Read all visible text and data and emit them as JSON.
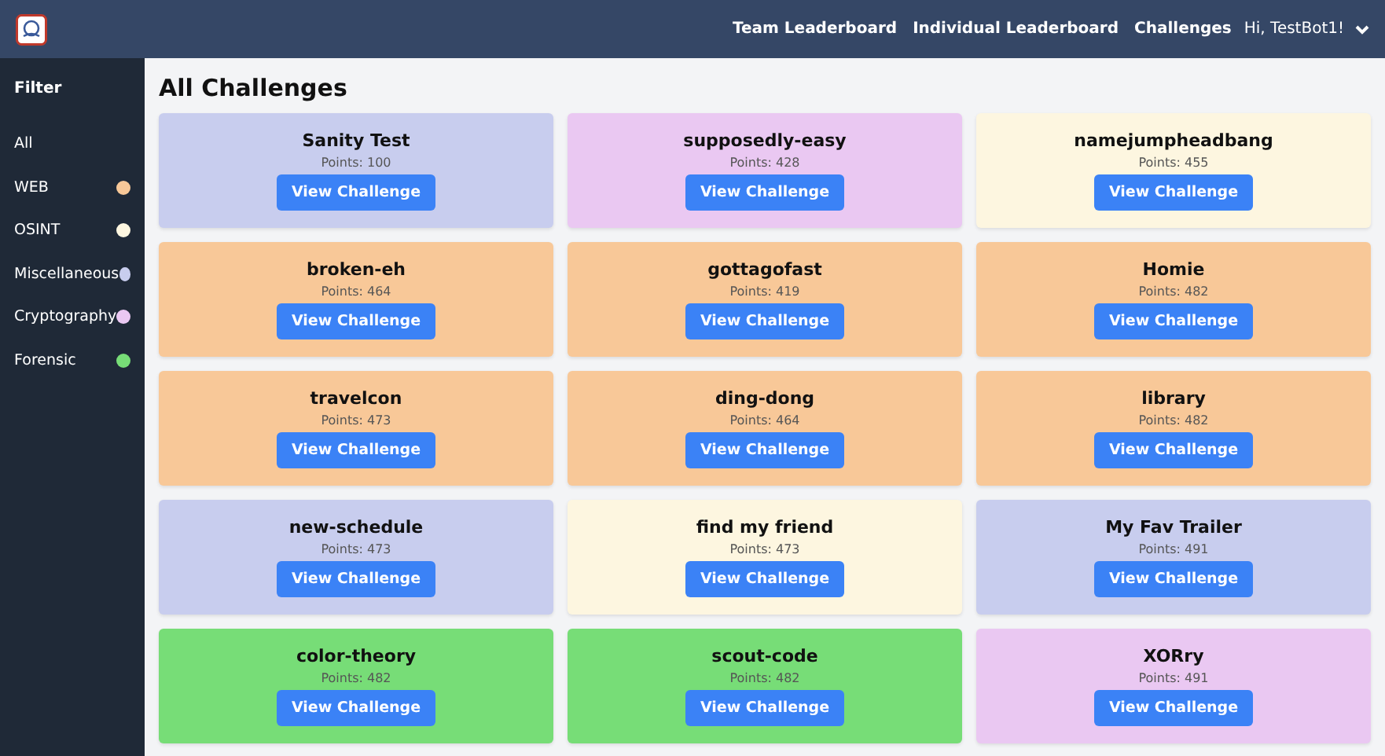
{
  "nav": {
    "links": [
      "Team Leaderboard",
      "Individual Leaderboard",
      "Challenges"
    ],
    "user": "Hi, TestBot1!"
  },
  "sidebar": {
    "title": "Filter",
    "items": [
      {
        "label": "All"
      },
      {
        "label": "WEB",
        "color": "#f8c898"
      },
      {
        "label": "OSINT",
        "color": "#fdf6e0"
      },
      {
        "label": "Miscellaneous",
        "color": "#c8cdee"
      },
      {
        "label": "Cryptography",
        "color": "#eac8f2"
      },
      {
        "label": "Forensic",
        "color": "#77dd77"
      }
    ]
  },
  "heading": "All Challenges",
  "challenges": [
    {
      "name": "Sanity Test",
      "points": "Points: 100",
      "color": "#c8cdee",
      "button": "View Challenge"
    },
    {
      "name": "supposedly-easy",
      "points": "Points: 428",
      "color": "#eac8f2",
      "button": "View Challenge"
    },
    {
      "name": "namejumpheadbang",
      "points": "Points: 455",
      "color": "#fdf6e0",
      "button": "View Challenge"
    },
    {
      "name": "broken-eh",
      "points": "Points: 464",
      "color": "#f8c898",
      "button": "View Challenge"
    },
    {
      "name": "gottagofast",
      "points": "Points: 419",
      "color": "#f8c898",
      "button": "View Challenge"
    },
    {
      "name": "Homie",
      "points": "Points: 482",
      "color": "#f8c898",
      "button": "View Challenge"
    },
    {
      "name": "travelcon",
      "points": "Points: 473",
      "color": "#f8c898",
      "button": "View Challenge"
    },
    {
      "name": "ding-dong",
      "points": "Points: 464",
      "color": "#f8c898",
      "button": "View Challenge"
    },
    {
      "name": "library",
      "points": "Points: 482",
      "color": "#f8c898",
      "button": "View Challenge"
    },
    {
      "name": "new-schedule",
      "points": "Points: 473",
      "color": "#c8cdee",
      "button": "View Challenge"
    },
    {
      "name": "find my friend",
      "points": "Points: 473",
      "color": "#fdf6e0",
      "button": "View Challenge"
    },
    {
      "name": "My Fav Trailer",
      "points": "Points: 491",
      "color": "#c8cdee",
      "button": "View Challenge"
    },
    {
      "name": "color-theory",
      "points": "Points: 482",
      "color": "#77dd77",
      "button": "View Challenge"
    },
    {
      "name": "scout-code",
      "points": "Points: 482",
      "color": "#77dd77",
      "button": "View Challenge"
    },
    {
      "name": "XORry",
      "points": "Points: 491",
      "color": "#eac8f2",
      "button": "View Challenge"
    }
  ]
}
